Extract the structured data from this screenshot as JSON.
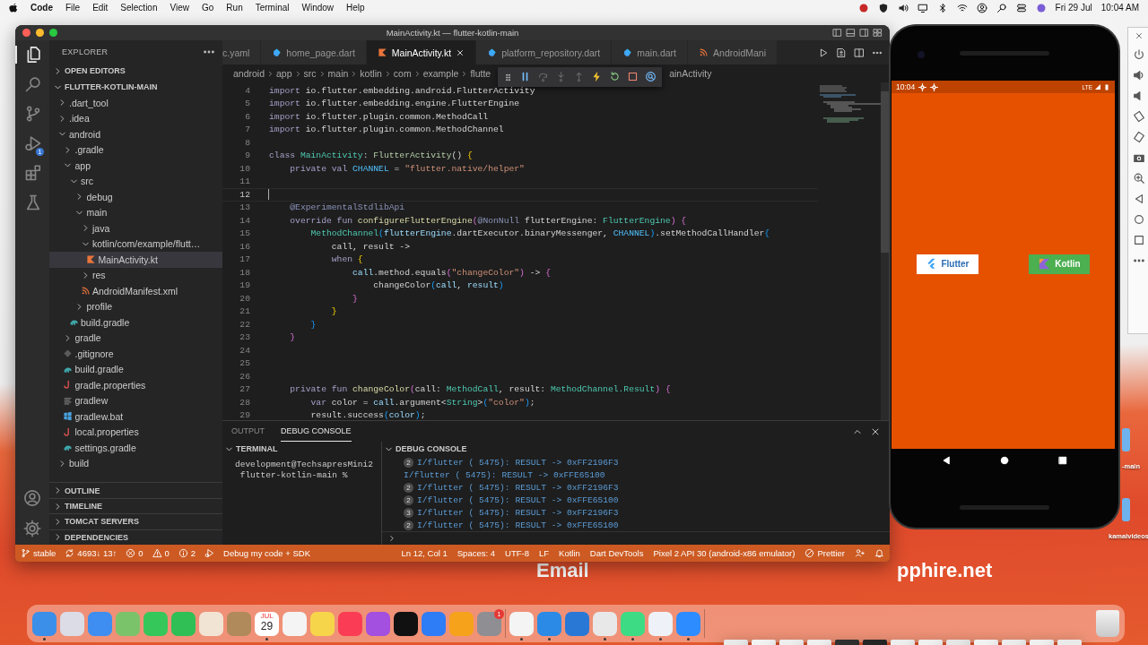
{
  "menubar": {
    "menus": [
      "Code",
      "File",
      "Edit",
      "Selection",
      "View",
      "Go",
      "Run",
      "Terminal",
      "Window",
      "Help"
    ],
    "date": "Fri 29 Jul",
    "time": "10:04 AM"
  },
  "window": {
    "title": "MainActivity.kt — flutter-kotlin-main"
  },
  "activity_bar": {
    "items": [
      {
        "kind": "explorer",
        "selected": true
      },
      {
        "kind": "search",
        "selected": false
      },
      {
        "kind": "source-control",
        "selected": false
      },
      {
        "kind": "debug",
        "selected": false,
        "badge": "1"
      },
      {
        "kind": "extensions",
        "selected": false
      },
      {
        "kind": "testing",
        "selected": false
      }
    ]
  },
  "sidebar": {
    "title": "EXPLORER",
    "sections_top": [
      {
        "label": "OPEN EDITORS",
        "expanded": false
      },
      {
        "label": "FLUTTER-KOTLIN-MAIN",
        "expanded": true
      }
    ],
    "tree": [
      {
        "label": ".dart_tool",
        "kind": "folder",
        "expanded": false,
        "selected": false
      },
      {
        "label": ".idea",
        "kind": "folder",
        "expanded": false,
        "selected": false
      },
      {
        "label": "android",
        "kind": "folder",
        "expanded": true,
        "selected": false,
        "children": [
          {
            "label": ".gradle",
            "kind": "folder",
            "expanded": false,
            "selected": false
          },
          {
            "label": "app",
            "kind": "folder",
            "expanded": true,
            "selected": false,
            "children": [
              {
                "label": "src",
                "kind": "folder",
                "expanded": true,
                "selected": false,
                "children": [
                  {
                    "label": "debug",
                    "kind": "folder",
                    "expanded": false,
                    "selected": false
                  },
                  {
                    "label": "main",
                    "kind": "folder",
                    "expanded": true,
                    "selected": false,
                    "children": [
                      {
                        "label": "java",
                        "kind": "folder",
                        "expanded": false,
                        "selected": false
                      },
                      {
                        "label": "kotlin/com/example/flutt…",
                        "kind": "folder",
                        "expanded": true,
                        "selected": false,
                        "children": [
                          {
                            "label": "MainActivity.kt",
                            "kind": "kotlin",
                            "selected": true
                          }
                        ]
                      },
                      {
                        "label": "res",
                        "kind": "folder",
                        "expanded": false,
                        "selected": false
                      },
                      {
                        "label": "AndroidManifest.xml",
                        "kind": "xml",
                        "selected": false
                      }
                    ]
                  },
                  {
                    "label": "profile",
                    "kind": "folder",
                    "expanded": false,
                    "selected": false
                  }
                ]
              },
              {
                "label": "build.gradle",
                "kind": "gradle",
                "selected": false
              }
            ]
          },
          {
            "label": "gradle",
            "kind": "folder",
            "expanded": false,
            "selected": false
          },
          {
            "label": ".gitignore",
            "kind": "git",
            "selected": false
          },
          {
            "label": "build.gradle",
            "kind": "gradle",
            "selected": false
          },
          {
            "label": "gradle.properties",
            "kind": "properties",
            "selected": false
          },
          {
            "label": "gradlew",
            "kind": "text",
            "selected": false
          },
          {
            "label": "gradlew.bat",
            "kind": "windows",
            "selected": false
          },
          {
            "label": "local.properties",
            "kind": "properties",
            "selected": false
          },
          {
            "label": "settings.gradle",
            "kind": "gradle",
            "selected": false
          }
        ]
      },
      {
        "label": "build",
        "kind": "folder",
        "expanded": false,
        "selected": false
      }
    ],
    "sections_bottom": [
      {
        "label": "OUTLINE",
        "expanded": false
      },
      {
        "label": "TIMELINE",
        "expanded": false
      },
      {
        "label": "TOMCAT SERVERS",
        "expanded": false
      },
      {
        "label": "DEPENDENCIES",
        "expanded": false
      }
    ]
  },
  "tabs": [
    {
      "label": "c.yaml",
      "kind": "yaml",
      "selected": false
    },
    {
      "label": "home_page.dart",
      "kind": "dart",
      "selected": false
    },
    {
      "label": "MainActivity.kt",
      "kind": "kotlin",
      "selected": true
    },
    {
      "label": "platform_repository.dart",
      "kind": "dart",
      "selected": false
    },
    {
      "label": "main.dart",
      "kind": "dart",
      "selected": false
    },
    {
      "label": "AndroidMani",
      "kind": "xml",
      "selected": false
    }
  ],
  "breadcrumbs": {
    "before": [
      "android",
      "app",
      "src",
      "main",
      "kotlin",
      "com",
      "example",
      "flutte"
    ],
    "after": "ainActivity"
  },
  "editor": {
    "lines": [
      {
        "n": "4",
        "current": false,
        "tokens": [
          {
            "text": "import",
            "kind": "kw"
          },
          {
            "text": " io.flutter.embedding.android.FlutterActivity",
            "kind": "plain"
          }
        ]
      },
      {
        "n": "5",
        "current": false,
        "tokens": [
          {
            "text": "import",
            "kind": "kw"
          },
          {
            "text": " io.flutter.embedding.engine.FlutterEngine",
            "kind": "plain"
          }
        ]
      },
      {
        "n": "6",
        "current": false,
        "tokens": [
          {
            "text": "import",
            "kind": "kw"
          },
          {
            "text": " io.flutter.plugin.common.MethodCall",
            "kind": "plain"
          }
        ]
      },
      {
        "n": "7",
        "current": false,
        "tokens": [
          {
            "text": "import",
            "kind": "kw"
          },
          {
            "text": " io.flutter.plugin.common.MethodChannel",
            "kind": "plain"
          }
        ]
      },
      {
        "n": "8",
        "current": false
      },
      {
        "n": "9",
        "current": false,
        "tokens": [
          {
            "text": "class",
            "kind": "kw"
          },
          {
            "text": " MainActivity",
            "kind": "type"
          },
          {
            "text": ": ",
            "kind": "plain"
          },
          {
            "text": "FlutterActivity",
            "kind": "type2"
          },
          {
            "text": "() ",
            "kind": "plain"
          },
          {
            "text": "{",
            "kind": "b1"
          }
        ]
      },
      {
        "n": "10",
        "current": false,
        "tokens": [
          {
            "text": "    private val",
            "kind": "kw"
          },
          {
            "text": " CHANNEL",
            "kind": "const"
          },
          {
            "text": " = ",
            "kind": "plain"
          },
          {
            "text": "\"flutter.native/helper\"",
            "kind": "string"
          }
        ]
      },
      {
        "n": "11",
        "current": false
      },
      {
        "n": "12",
        "current": true
      },
      {
        "n": "13",
        "current": false,
        "tokens": [
          {
            "text": "    @ExperimentalStdlibApi",
            "kind": "annot"
          }
        ]
      },
      {
        "n": "14",
        "current": false,
        "tokens": [
          {
            "text": "    override fun",
            "kind": "kw"
          },
          {
            "text": " configureFlutterEngine",
            "kind": "func"
          },
          {
            "text": "(",
            "kind": "b2"
          },
          {
            "text": "@NonNull",
            "kind": "annot"
          },
          {
            "text": " flutterEngine: ",
            "kind": "plain"
          },
          {
            "text": "FlutterEngine",
            "kind": "type"
          },
          {
            "text": ") ",
            "kind": "b2"
          },
          {
            "text": "{",
            "kind": "b2"
          }
        ]
      },
      {
        "n": "15",
        "current": false,
        "tokens": [
          {
            "text": "        MethodChannel",
            "kind": "type"
          },
          {
            "text": "(",
            "kind": "b3"
          },
          {
            "text": "flutterEngine",
            "kind": "var"
          },
          {
            "text": ".dartExecutor.binaryMessenger, ",
            "kind": "plain"
          },
          {
            "text": "CHANNEL",
            "kind": "const"
          },
          {
            "text": ")",
            "kind": "b3"
          },
          {
            "text": ".setMethodCallHandler",
            "kind": "plain"
          },
          {
            "text": "{",
            "kind": "b3"
          }
        ]
      },
      {
        "n": "16",
        "current": false,
        "tokens": [
          {
            "text": "            call, result ->",
            "kind": "plain"
          }
        ]
      },
      {
        "n": "17",
        "current": false,
        "tokens": [
          {
            "text": "            when",
            "kind": "kw"
          },
          {
            "text": " {",
            "kind": "b1"
          }
        ]
      },
      {
        "n": "18",
        "current": false,
        "tokens": [
          {
            "text": "                call",
            "kind": "var"
          },
          {
            "text": ".method.equals",
            "kind": "plain"
          },
          {
            "text": "(",
            "kind": "b2"
          },
          {
            "text": "\"changeColor\"",
            "kind": "string"
          },
          {
            "text": ")",
            "kind": "b2"
          },
          {
            "text": " -> ",
            "kind": "plain"
          },
          {
            "text": "{",
            "kind": "b2"
          }
        ]
      },
      {
        "n": "19",
        "current": false,
        "tokens": [
          {
            "text": "                    changeColor",
            "kind": "plain"
          },
          {
            "text": "(",
            "kind": "b3"
          },
          {
            "text": "call",
            "kind": "var"
          },
          {
            "text": ", ",
            "kind": "plain"
          },
          {
            "text": "result",
            "kind": "var"
          },
          {
            "text": ")",
            "kind": "b3"
          }
        ]
      },
      {
        "n": "20",
        "current": false,
        "tokens": [
          {
            "text": "                }",
            "kind": "b2"
          }
        ]
      },
      {
        "n": "21",
        "current": false,
        "tokens": [
          {
            "text": "            }",
            "kind": "b1"
          }
        ]
      },
      {
        "n": "22",
        "current": false,
        "tokens": [
          {
            "text": "        }",
            "kind": "b3"
          }
        ]
      },
      {
        "n": "23",
        "current": false,
        "tokens": [
          {
            "text": "    }",
            "kind": "b2"
          }
        ]
      },
      {
        "n": "24",
        "current": false
      },
      {
        "n": "25",
        "current": false
      },
      {
        "n": "26",
        "current": false
      },
      {
        "n": "27",
        "current": false,
        "tokens": [
          {
            "text": "    private fun",
            "kind": "kw"
          },
          {
            "text": " changeColor",
            "kind": "func"
          },
          {
            "text": "(",
            "kind": "b2"
          },
          {
            "text": "call: ",
            "kind": "plain"
          },
          {
            "text": "MethodCall",
            "kind": "type"
          },
          {
            "text": ", result: ",
            "kind": "plain"
          },
          {
            "text": "MethodChannel.Result",
            "kind": "type"
          },
          {
            "text": ") ",
            "kind": "b2"
          },
          {
            "text": "{",
            "kind": "b2"
          }
        ]
      },
      {
        "n": "28",
        "current": false,
        "tokens": [
          {
            "text": "        var",
            "kind": "kw"
          },
          {
            "text": " color = ",
            "kind": "plain"
          },
          {
            "text": "call",
            "kind": "var"
          },
          {
            "text": ".argument<",
            "kind": "plain"
          },
          {
            "text": "String",
            "kind": "type"
          },
          {
            "text": ">",
            "kind": "plain"
          },
          {
            "text": "(",
            "kind": "b3"
          },
          {
            "text": "\"color\"",
            "kind": "string"
          },
          {
            "text": ")",
            "kind": "b3"
          },
          {
            "text": ";",
            "kind": "plain"
          }
        ]
      },
      {
        "n": "29",
        "current": false,
        "tokens": [
          {
            "text": "        result.success",
            "kind": "plain"
          },
          {
            "text": "(",
            "kind": "b3"
          },
          {
            "text": "color",
            "kind": "var"
          },
          {
            "text": ")",
            "kind": "b3"
          },
          {
            "text": ";",
            "kind": "plain"
          }
        ]
      }
    ]
  },
  "panel": {
    "tabs": [
      {
        "label": "OUTPUT",
        "selected": false
      },
      {
        "label": "DEBUG CONSOLE",
        "selected": true
      }
    ],
    "terminal": {
      "title": "TERMINAL",
      "lines": [
        "development@TechsapresMini2",
        " flutter-kotlin-main %"
      ]
    },
    "console": {
      "title": "DEBUG CONSOLE",
      "lines": [
        {
          "count": "2",
          "text": "I/flutter ( 5475): RESULT -> 0xFF2196F3"
        },
        {
          "text": "I/flutter ( 5475): RESULT -> 0xFFE65100"
        },
        {
          "count": "2",
          "text": "I/flutter ( 5475): RESULT -> 0xFF2196F3"
        },
        {
          "count": "2",
          "text": "I/flutter ( 5475): RESULT -> 0xFFE65100"
        },
        {
          "count": "3",
          "text": "I/flutter ( 5475): RESULT -> 0xFF2196F3"
        },
        {
          "count": "2",
          "text": "I/flutter ( 5475): RESULT -> 0xFFE65100"
        }
      ]
    }
  },
  "status_bar": {
    "left": [
      {
        "kind": "branch",
        "text": "stable"
      },
      {
        "kind": "sync",
        "text": "4693↓ 13↑"
      },
      {
        "kind": "error",
        "text": "0"
      },
      {
        "kind": "warning",
        "text": "0"
      },
      {
        "kind": "info",
        "text": "2"
      },
      {
        "kind": "debug"
      },
      {
        "text": "Debug my code + SDK"
      }
    ],
    "right": [
      {
        "text": "Ln 12, Col 1"
      },
      {
        "text": "Spaces: 4"
      },
      {
        "text": "UTF-8"
      },
      {
        "text": "LF"
      },
      {
        "text": "Kotlin"
      },
      {
        "text": "Dart DevTools"
      },
      {
        "text": "Pixel 2 API 30 (android-x86 emulator)"
      },
      {
        "kind": "blocked",
        "text": "Prettier"
      },
      {
        "kind": "feedback"
      },
      {
        "kind": "bell"
      }
    ]
  },
  "phone": {
    "time": "10:04",
    "network": "LTE",
    "buttons": [
      {
        "label": "Flutter",
        "kind": "flutter"
      },
      {
        "label": "Kotlin",
        "kind": "kotlin"
      }
    ]
  },
  "desktop": {
    "banner": [
      "Email",
      "pphire.net"
    ],
    "icons": [
      {
        "label": "-main"
      },
      {
        "label": "kamalvideos"
      }
    ]
  },
  "dock": {
    "items": [
      {
        "kind": "app",
        "color": "#3b8fe8",
        "running": true
      },
      {
        "kind": "app",
        "color": "#dcdce6",
        "running": false
      },
      {
        "kind": "app",
        "color": "#3d8ef0",
        "running": false
      },
      {
        "kind": "app",
        "color": "#7bc36a",
        "running": false
      },
      {
        "kind": "app",
        "color": "#35c759",
        "running": false
      },
      {
        "kind": "app",
        "color": "#2fbf55",
        "running": false
      },
      {
        "kind": "app",
        "color": "#f2e4d4",
        "running": false
      },
      {
        "kind": "app",
        "color": "#b08a5a",
        "running": false
      },
      {
        "kind": "calendar",
        "month": "JUL",
        "day": "29",
        "running": true
      },
      {
        "kind": "app",
        "color": "#f4f4f4",
        "running": false
      },
      {
        "kind": "app",
        "color": "#f7d54a",
        "running": false
      },
      {
        "kind": "app",
        "color": "#fa3c55",
        "running": false
      },
      {
        "kind": "app",
        "color": "#a34fe0",
        "running": false
      },
      {
        "kind": "app",
        "color": "#111111",
        "running": false
      },
      {
        "kind": "app",
        "color": "#2e7cf6",
        "running": false
      },
      {
        "kind": "app",
        "color": "#f7a21b",
        "running": false
      },
      {
        "kind": "app",
        "color": "#8e8e93",
        "running": false,
        "badge": "1"
      },
      {
        "kind": "separator"
      },
      {
        "kind": "app",
        "color": "#f4f4f4",
        "running": true
      },
      {
        "kind": "app",
        "color": "#2a8ae6",
        "running": true
      },
      {
        "kind": "app",
        "color": "#2a78d6",
        "running": false
      },
      {
        "kind": "app",
        "color": "#e8e8e8",
        "running": true
      },
      {
        "kind": "app",
        "color": "#3ddc84",
        "running": true
      },
      {
        "kind": "app",
        "color": "#eef2f8",
        "running": true
      },
      {
        "kind": "app",
        "color": "#2d8cff",
        "running": true
      },
      {
        "kind": "separator"
      },
      {
        "kind": "window",
        "color": "#e9e9e9"
      },
      {
        "kind": "window",
        "color": "#f2f2f2"
      },
      {
        "kind": "window",
        "color": "#eeeeee"
      },
      {
        "kind": "window",
        "color": "#f0f0f0"
      },
      {
        "kind": "window",
        "color": "#2f2f2f"
      },
      {
        "kind": "window",
        "color": "#262626"
      },
      {
        "kind": "window",
        "color": "#eeeeee"
      },
      {
        "kind": "window",
        "color": "#f0f0f0"
      },
      {
        "kind": "window",
        "color": "#e6e6e6"
      },
      {
        "kind": "window",
        "color": "#f2f2f2"
      },
      {
        "kind": "window",
        "color": "#ececec"
      },
      {
        "kind": "window",
        "color": "#f0f0f0"
      },
      {
        "kind": "window",
        "color": "#eaeaea"
      },
      {
        "kind": "trash"
      }
    ]
  }
}
